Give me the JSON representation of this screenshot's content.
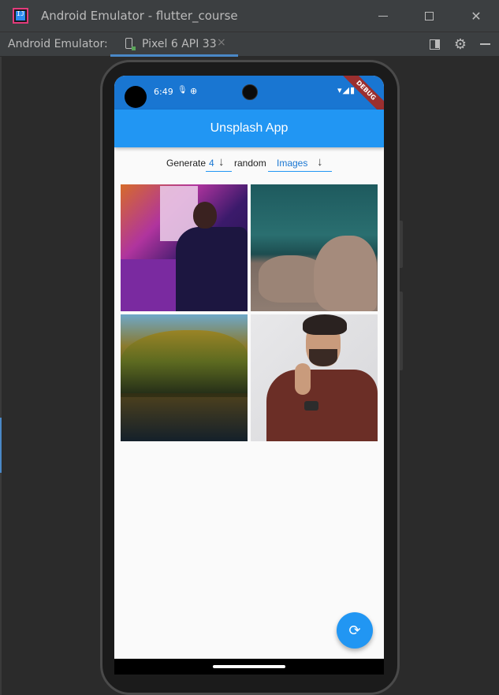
{
  "window": {
    "title": "Android Emulator - flutter_course",
    "app_icon_text": "IJ",
    "minimize_glyph": "",
    "close_glyph": "✕"
  },
  "toolbar": {
    "label": "Android Emulator:",
    "device_tab": "Pixel 6 API 33",
    "tab_close_glyph": "×",
    "gear_glyph": "⚙"
  },
  "status_bar": {
    "time": "6:49",
    "mic_glyph": "🎙",
    "target_glyph": "⊕",
    "right_icons": "▾◢▮",
    "debug_banner": "DEBUG"
  },
  "app": {
    "title": "Unsplash App",
    "generate_prefix": "Generate",
    "count_value": "4",
    "random_text": "random",
    "type_value": "Images",
    "arrow_glyph": "↓",
    "refresh_glyph": "⟳",
    "images": [
      {
        "name": "man-at-neon-bar"
      },
      {
        "name": "rocky-coast-sea"
      },
      {
        "name": "forest-lake"
      },
      {
        "name": "man-in-turtleneck"
      }
    ]
  },
  "colors": {
    "app_bar": "#2196f3",
    "status_bar": "#1976d2",
    "accent": "#1976d2",
    "ide_background": "#3c3f41"
  }
}
